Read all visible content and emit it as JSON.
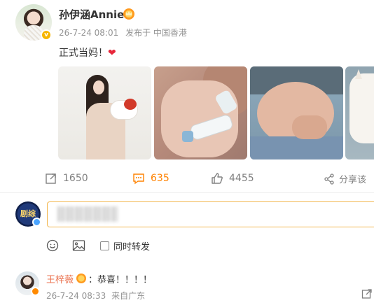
{
  "post": {
    "author": "孙伊涵Annie",
    "time": "26-7-24 08:01",
    "location": "发布于 中国香港",
    "text": "正式当妈！",
    "emoji": "❤"
  },
  "actions": {
    "repost_count": "1650",
    "comment_count": "635",
    "like_count": "4455",
    "share_label": "分享该"
  },
  "composer": {
    "avatar_text": "剧综",
    "input_value": "",
    "forward_label": "同时转发"
  },
  "comment": {
    "author": "王梓薇",
    "text": "：恭喜！！！！",
    "time": "26-7-24 08:33",
    "location": "来自广东"
  },
  "colors": {
    "accent_orange": "#ff8200",
    "comment_name": "#eb7350",
    "input_border": "#f2b74f",
    "verified_gold": "#f7b500"
  }
}
